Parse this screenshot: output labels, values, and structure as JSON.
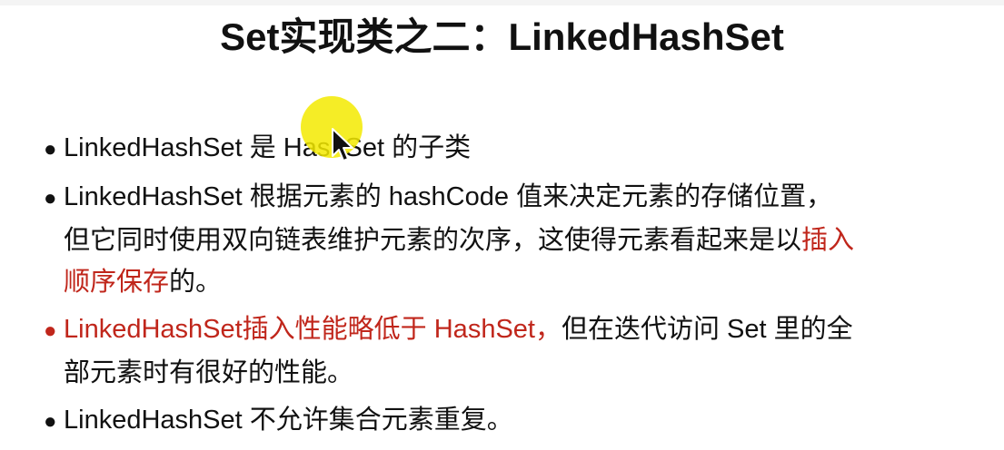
{
  "slide": {
    "title": "Set实现类之二：LinkedHashSet",
    "bullets": [
      {
        "dot": "●",
        "text": "LinkedHashSet 是 HashSet 的子类"
      },
      {
        "dot": "●",
        "line1": "LinkedHashSet 根据元素的 hashCode 值来决定元素的存储位置，",
        "line2_plain": "但它同时使用双向链表维护元素的次序，这使得元素看起来是以",
        "line2_red": "插入",
        "line3_red": "顺序保存",
        "line3_plain": "的。"
      },
      {
        "dot": "●",
        "line1_red": "LinkedHashSet插入性能略低于 HashSet，",
        "line1_plain": "但在迭代访问 Set 里的全",
        "line2": "部元素时有很好的性能。"
      },
      {
        "dot": "●",
        "text": "LinkedHashSet 不允许集合元素重复。"
      }
    ]
  },
  "cursor": {
    "icon": "mouse-pointer-arrow-icon",
    "highlight_color": "#f3ea00"
  },
  "colors": {
    "text": "#111111",
    "accent_red": "#c0261b",
    "background": "#ffffff"
  }
}
